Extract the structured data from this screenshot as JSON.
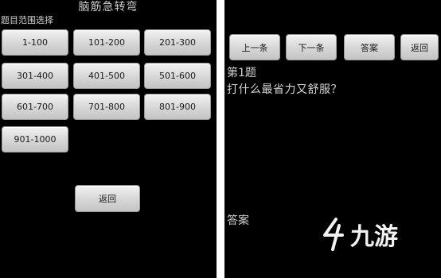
{
  "left_screen": {
    "title": "脑筋急转弯",
    "subtitle": "题目范围选择",
    "ranges": [
      "1-100",
      "101-200",
      "201-300",
      "301-400",
      "401-500",
      "501-600",
      "601-700",
      "701-800",
      "801-900",
      "901-1000"
    ],
    "back_label": "返回"
  },
  "right_screen": {
    "nav": {
      "prev_label": "上一条",
      "next_label": "下一条",
      "answer_label": "答案",
      "back_label": "返回"
    },
    "question_number": "第1题",
    "question_text": "打什么最省力又舒服？",
    "answer_heading": "答案"
  },
  "watermark": {
    "text": "九游",
    "icon": "nine-game-logo-icon"
  }
}
